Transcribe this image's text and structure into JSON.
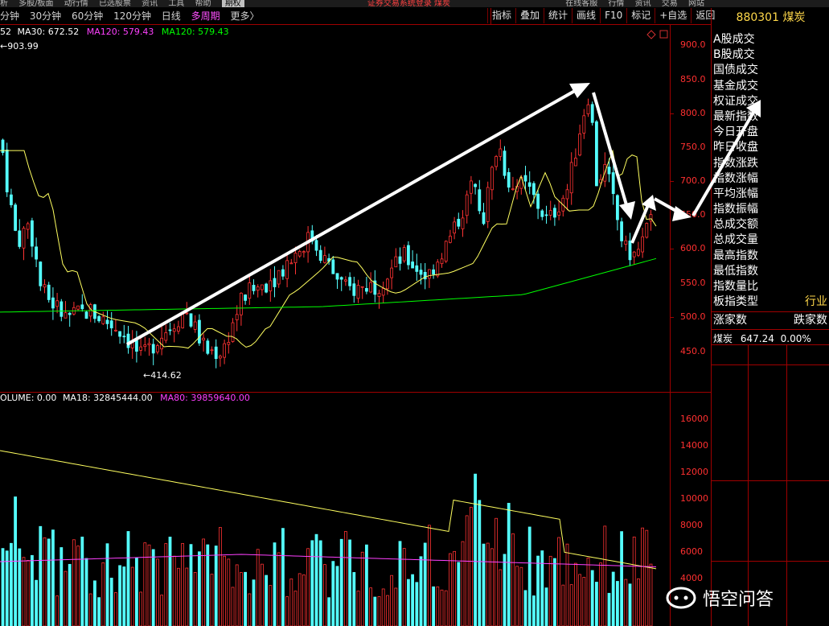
{
  "topbar": {
    "items": [
      "析",
      "多股/板面",
      "动行情",
      "已选股票",
      "资讯",
      "工具",
      "帮助",
      "期权"
    ],
    "center_text": "证券交易系统登录 煤炭",
    "right_items": [
      "在线客服",
      "行情",
      "资讯",
      "交易",
      "网站"
    ]
  },
  "periods": [
    "分钟",
    "30分钟",
    "60分钟",
    "120分钟",
    "日线",
    "多周期",
    "更多〉"
  ],
  "active_period": "多周期",
  "toolbar": [
    "指标",
    "叠加",
    "统计",
    "画线",
    "F10",
    "标记",
    "+自选",
    "返回"
  ],
  "stock": {
    "code": "880301",
    "name": "煤炭"
  },
  "ma_line": {
    "ma_prefix": "52",
    "ma30_label": "MA30: 672.52",
    "ma120_label": "MA120: 579.43",
    "ma120b_label": "MA120: 579.43"
  },
  "price_high_label": "903.99",
  "price_low_label": "414.62",
  "price_axis": [
    "900.0",
    "850.0",
    "800.0",
    "750.0",
    "700.0",
    "650.0",
    "600.0",
    "550.0",
    "500.0",
    "450.0"
  ],
  "volume_legend": {
    "volume": "OLUME: 0.00",
    "ma18": "MA18: 32845444.00",
    "ma80": "MA80: 39859640.00"
  },
  "volume_axis": [
    "16000",
    "14000",
    "12000",
    "10000",
    "8000",
    "6000",
    "4000"
  ],
  "right_panel": {
    "items": [
      "A股成交",
      "B股成交",
      "国债成交",
      "基金成交",
      "权证成交",
      "最新指数",
      "今日开盘",
      "昨日收盘",
      "指数涨跌",
      "指数涨幅",
      "平均涨幅",
      "指数振幅",
      "总成交额",
      "总成交量",
      "最高指数",
      "最低指数",
      "指数量比",
      "板指类型"
    ],
    "type_value": "行业",
    "up_label": "涨家数",
    "down_label": "跌家数",
    "mini_name": "煤炭",
    "mini_value": "647.24",
    "mini_pct": "0.00%"
  },
  "watermark": {
    "text": "悟空问答"
  },
  "colors": {
    "up": "#ff3333",
    "down": "#54ffff",
    "ma_yellow": "#ffff60",
    "ma_green": "#00ff00",
    "ma_magenta": "#ff40ff",
    "frame": "#a00000"
  }
}
